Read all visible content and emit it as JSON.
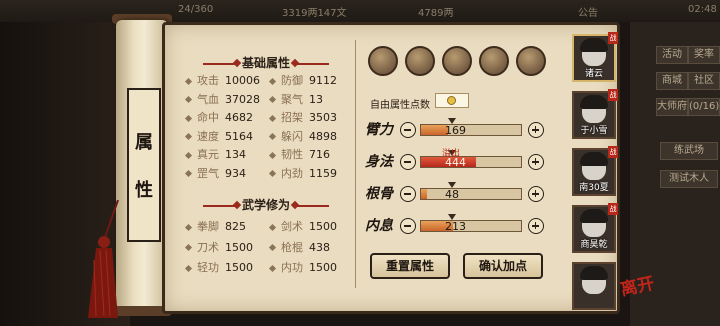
{
  "top_bar": {
    "energy": "24/360",
    "copper": "3319两147文",
    "silver": "4789两",
    "notice": "公告",
    "time": "02:48"
  },
  "side_menu": [
    "活动",
    "奖率",
    "商城",
    "社区",
    "大师府",
    "(0/16)"
  ],
  "side_actions": [
    "练武场",
    "测试木人"
  ],
  "scroll_title": [
    "属",
    "性"
  ],
  "basic": {
    "title": "基础属性",
    "rows": [
      [
        {
          "label": "攻击",
          "value": "10006"
        },
        {
          "label": "防御",
          "value": "9112"
        }
      ],
      [
        {
          "label": "气血",
          "value": "37028"
        },
        {
          "label": "聚气",
          "value": "13"
        }
      ],
      [
        {
          "label": "命中",
          "value": "4682"
        },
        {
          "label": "招架",
          "value": "3503"
        }
      ],
      [
        {
          "label": "速度",
          "value": "5164"
        },
        {
          "label": "躲闪",
          "value": "4898"
        }
      ],
      [
        {
          "label": "真元",
          "value": "134"
        },
        {
          "label": "韧性",
          "value": "716"
        }
      ],
      [
        {
          "label": "罡气",
          "value": "934"
        },
        {
          "label": "内劲",
          "value": "1159"
        }
      ]
    ]
  },
  "martial": {
    "title": "武学修为",
    "rows": [
      [
        {
          "label": "拳脚",
          "value": "825"
        },
        {
          "label": "剑术",
          "value": "1500"
        }
      ],
      [
        {
          "label": "刀术",
          "value": "1500"
        },
        {
          "label": "枪棍",
          "value": "438"
        }
      ],
      [
        {
          "label": "轻功",
          "value": "1500"
        },
        {
          "label": "内功",
          "value": "1500"
        }
      ]
    ]
  },
  "equipment_icons": [
    "hat-icon",
    "armor-icon",
    "chest-icon",
    "ring-icon",
    "baby-icon",
    "pearl-icon"
  ],
  "free_points_label": "自由属性点数",
  "free_points_value": "0",
  "attributes": [
    {
      "name": "臂力",
      "value": "169",
      "fill": 0.27,
      "warn": false
    },
    {
      "name": "身法",
      "value": "444",
      "fill": 0.55,
      "warn": true
    },
    {
      "name": "根骨",
      "value": "48",
      "fill": 0.06,
      "warn": false
    },
    {
      "name": "内息",
      "value": "213",
      "fill": 0.32,
      "warn": false
    }
  ],
  "overflow_label": "溢出",
  "buttons": {
    "reset": "重置属性",
    "confirm": "确认加点"
  },
  "characters": [
    {
      "name": "诸云"
    },
    {
      "name": "于小雪"
    },
    {
      "name": "南30夏"
    },
    {
      "name": "商昊乾"
    },
    {
      "name": ""
    }
  ],
  "char_tag": "战",
  "leave_label": "离开"
}
